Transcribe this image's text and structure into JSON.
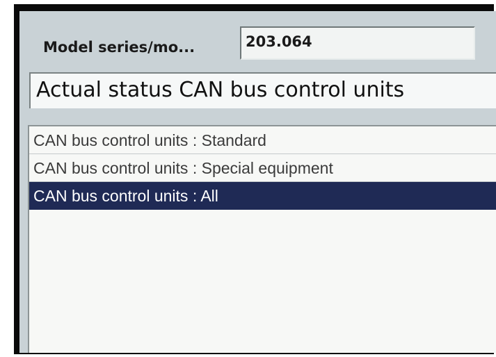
{
  "header": {
    "model_label": "Model series/mo...",
    "model_value": "203.064"
  },
  "title": "Actual status CAN bus control units",
  "list": {
    "items": [
      {
        "label": "CAN bus control units : Standard",
        "selected": false
      },
      {
        "label": "CAN bus control units : Special equipment",
        "selected": false
      },
      {
        "label": "CAN bus control units : All",
        "selected": true
      }
    ]
  },
  "colors": {
    "selection": "#1f2a55",
    "screen_background": "#c9d2d6",
    "bezel": "#0a0a0a"
  }
}
